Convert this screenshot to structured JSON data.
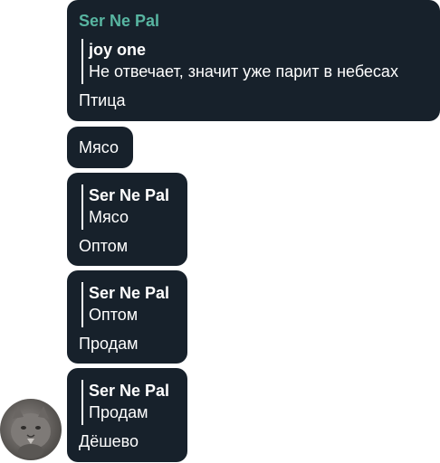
{
  "messages": [
    {
      "sender": "Ser Ne Pal",
      "reply": {
        "author": "joy one",
        "text": "Не отвечает, значит уже парит в небесах"
      },
      "text": "Птица"
    },
    {
      "text": "Мясо"
    },
    {
      "reply": {
        "author": "Ser Ne Pal",
        "text": "Мясо"
      },
      "text": "Оптом"
    },
    {
      "reply": {
        "author": "Ser Ne Pal",
        "text": "Оптом"
      },
      "text": "Продам"
    },
    {
      "reply": {
        "author": "Ser Ne Pal",
        "text": "Продам"
      },
      "text": "Дёшево"
    }
  ],
  "avatar_icon": "cat-photo-avatar",
  "colors": {
    "bubble_bg": "#17212b",
    "sender_name": "#58b5a1",
    "text": "#ffffff"
  }
}
